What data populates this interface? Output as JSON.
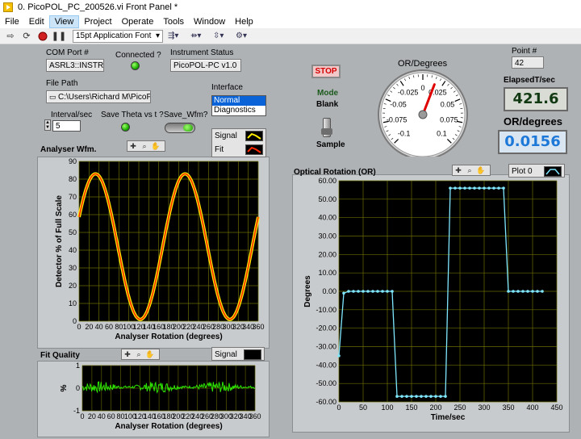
{
  "window": {
    "title": "0. PicoPOL_PC_200526.vi Front Panel *"
  },
  "menu": [
    "File",
    "Edit",
    "View",
    "Project",
    "Operate",
    "Tools",
    "Window",
    "Help"
  ],
  "menu_active": "View",
  "toolbar": {
    "font_select": "15pt Application Font"
  },
  "com_port": {
    "label": "COM Port #",
    "value": "ASRL3::INSTR"
  },
  "connected": {
    "label": "Connected ?"
  },
  "instrument_status": {
    "label": "Instrument Status",
    "value": "PicoPOL-PC v1.0"
  },
  "file_path": {
    "label": "File Path",
    "value": "C:\\Users\\Richard M\\PicoPOL"
  },
  "interface": {
    "label": "Interface",
    "options": [
      "Normal",
      "Diagnostics"
    ],
    "selected": "Normal"
  },
  "interval": {
    "label": "Interval/sec",
    "value": "5"
  },
  "save_theta": {
    "label": "Save Theta vs t ?"
  },
  "save_wfm": {
    "label": "Save_Wfm?"
  },
  "stop_button": "STOP",
  "mode": {
    "label": "Mode",
    "top": "Blank",
    "bottom": "Sample"
  },
  "gauge": {
    "label": "OR/Degrees",
    "ticks": [
      "-0.1",
      "-0.075",
      "-0.05",
      "-0.025",
      "0",
      "0.025",
      "0.05",
      "0.075",
      "0.1"
    ],
    "value": 0.0156,
    "range": [
      -0.1,
      0.1
    ]
  },
  "point": {
    "label": "Point #",
    "value": "42"
  },
  "elapsed": {
    "label": "ElapsedT/sec",
    "value": "421.6"
  },
  "or_degrees": {
    "label": "OR/degrees",
    "value": "0.0156"
  },
  "analyser_wfm": {
    "label": "Analyser Wfm.",
    "legend": [
      "Signal",
      "Fit"
    ],
    "colors": {
      "signal": "#ffee00",
      "fit": "#ff2a00",
      "grid": "#6b6b00"
    }
  },
  "fit_quality": {
    "label": "Fit Quality",
    "legend": "Signal",
    "color": "#2ee600"
  },
  "optical_rotation": {
    "label": "Optical Rotation (OR)",
    "legend": "Plot 0",
    "color": "#7fe7ff"
  },
  "chart_data": [
    {
      "type": "line",
      "title": "Analyser Wfm.",
      "xlabel": "Analyser Rotation (degrees)",
      "ylabel": "Detector % of Full Scale",
      "xlim": [
        0,
        360
      ],
      "ylim": [
        0,
        90
      ],
      "xticks": [
        0,
        20,
        40,
        60,
        80,
        100,
        120,
        140,
        160,
        180,
        200,
        220,
        240,
        260,
        280,
        300,
        320,
        340,
        360
      ],
      "yticks": [
        0,
        10,
        20,
        30,
        40,
        50,
        60,
        70,
        80,
        90
      ],
      "grid": true,
      "series": [
        {
          "name": "Signal",
          "model": "sine",
          "mean": 42,
          "amplitude": 41,
          "period_deg": 180,
          "peaks_at_deg": [
            33,
            213
          ]
        },
        {
          "name": "Fit",
          "model": "sine",
          "mean": 42,
          "amplitude": 41,
          "period_deg": 180,
          "peaks_at_deg": [
            33,
            213
          ]
        }
      ]
    },
    {
      "type": "line",
      "title": "Fit Quality",
      "xlabel": "Analyser Rotation (degrees)",
      "ylabel": "%",
      "xlim": [
        0,
        360
      ],
      "ylim": [
        -1,
        1
      ],
      "xticks": [
        0,
        20,
        40,
        60,
        80,
        100,
        120,
        140,
        160,
        180,
        200,
        220,
        240,
        260,
        280,
        300,
        320,
        340,
        360
      ],
      "yticks": [
        -1,
        0,
        1
      ],
      "grid": true,
      "series": [
        {
          "name": "Signal",
          "model": "noise",
          "mean": 0.05,
          "amplitude": 0.25
        }
      ]
    },
    {
      "type": "line",
      "title": "Optical Rotation (OR)",
      "xlabel": "Time/sec",
      "ylabel": "Degrees",
      "xlim": [
        0,
        450
      ],
      "ylim": [
        -60,
        60
      ],
      "xticks": [
        0,
        50,
        100,
        150,
        200,
        250,
        300,
        350,
        400,
        450
      ],
      "yticks": [
        -60,
        -50,
        -40,
        -30,
        -20,
        -10,
        0,
        10,
        20,
        30,
        40,
        50,
        60
      ],
      "grid": true,
      "series": [
        {
          "name": "Plot 0",
          "x": [
            0,
            10,
            20,
            30,
            40,
            50,
            60,
            70,
            80,
            90,
            100,
            110,
            120,
            130,
            140,
            150,
            160,
            170,
            180,
            190,
            200,
            210,
            220,
            230,
            240,
            250,
            260,
            270,
            280,
            290,
            300,
            310,
            320,
            330,
            340,
            350,
            360,
            370,
            380,
            390,
            400,
            410,
            420
          ],
          "y": [
            -35,
            -1,
            0,
            0,
            0,
            0,
            0,
            0,
            0,
            0,
            0,
            0,
            -57,
            -57,
            -57,
            -57,
            -57,
            -57,
            -57,
            -57,
            -57,
            -57,
            -57,
            56,
            56,
            56,
            56,
            56,
            56,
            56,
            56,
            56,
            56,
            56,
            56,
            0,
            0,
            0,
            0,
            0,
            0,
            0,
            0
          ]
        }
      ]
    }
  ]
}
